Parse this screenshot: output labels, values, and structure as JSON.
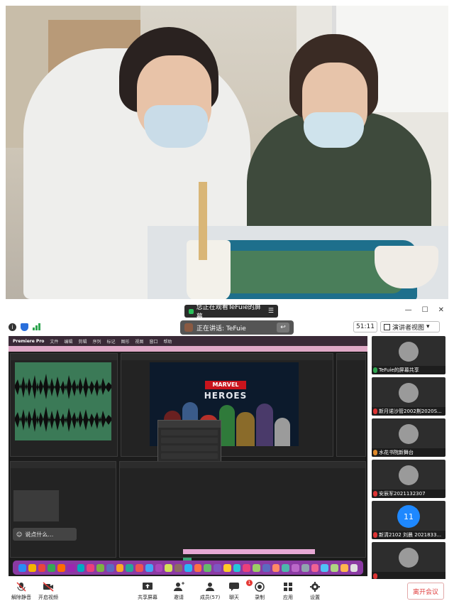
{
  "share_banner": {
    "text": "您正在观看TeFuie的屏幕"
  },
  "window": {
    "minimize": "—",
    "maximize": "☐",
    "close": "✕"
  },
  "toolbar": {
    "viewer_text": "正在讲话: TeFuie",
    "timer": "51:11",
    "view_label": "演讲者视图"
  },
  "screen": {
    "menu_items": [
      "Premiere Pro",
      "文件",
      "编辑",
      "剪辑",
      "序列",
      "标记",
      "图形",
      "视图",
      "窗口",
      "帮助"
    ],
    "marvel": "MARVEL",
    "heroes": "HEROES",
    "chat_placeholder": "说点什么…"
  },
  "participants": [
    {
      "name": "TeFuie的屏幕共享",
      "mic": "green"
    },
    {
      "name": "新月诺沙管2002荆2020S...",
      "mic": "red"
    },
    {
      "name": "水花书院新舞台",
      "mic": "orange"
    },
    {
      "name": "安辰军2021132307",
      "mic": "red"
    },
    {
      "name": "新清2102 刘晨 2021833...",
      "mic": "red",
      "avatar_number": "11"
    },
    {
      "name": "",
      "mic": "red"
    }
  ],
  "bottom_bar": {
    "unmute": "解除静音",
    "video": "开启视频",
    "share": "共享屏幕",
    "invite": "邀请",
    "members": "成员(57)",
    "chat": "聊天",
    "chat_badge": "1",
    "record": "录制",
    "apps": "应用",
    "settings": "设置",
    "leave": "离开会议"
  },
  "colors": {
    "accent": "#1e88ff",
    "leave": "#e04040",
    "dock": "#8b3aa3",
    "mic_on": "#2ea44f"
  }
}
